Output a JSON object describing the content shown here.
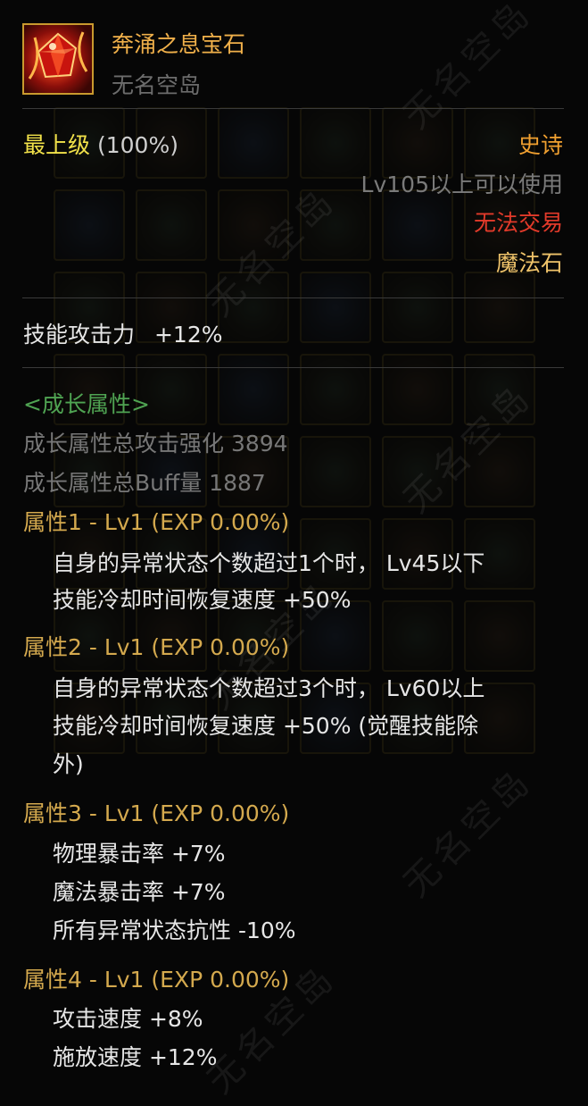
{
  "item": {
    "name": "奔涌之息宝石",
    "source": "无名空岛",
    "grade_name": "最上级",
    "grade_percent": "(100%)",
    "rarity": "史诗",
    "level_requirement": "Lv105以上可以使用",
    "trade_status": "无法交易",
    "category": "魔法石",
    "icon": "red-gem-icon"
  },
  "stats": {
    "skill_attack_label": "技能攻击力",
    "skill_attack_value": "+12%"
  },
  "growth": {
    "header": "<成长属性>",
    "total_attack_label": "成长属性总攻击强化 3894",
    "total_buff_label": "成长属性总Buff量 1887",
    "attributes": [
      {
        "title": "属性1 - Lv1 (EXP 0.00%)",
        "lines": [
          "自身的异常状态个数超过1个时， Lv45以下",
          "技能冷却时间恢复速度 +50%"
        ]
      },
      {
        "title": "属性2 - Lv1 (EXP 0.00%)",
        "lines": [
          "自身的异常状态个数超过3个时， Lv60以上",
          "技能冷却时间恢复速度 +50% (觉醒技能除",
          "外)"
        ]
      },
      {
        "title": "属性3 - Lv1 (EXP 0.00%)",
        "lines": [
          "物理暴击率 +7%",
          "魔法暴击率 +7%",
          "所有异常状态抗性 -10%"
        ]
      },
      {
        "title": "属性4 - Lv1 (EXP 0.00%)",
        "lines": [
          "攻击速度 +8%",
          "施放速度 +12%"
        ]
      }
    ]
  },
  "watermark": "无名空岛",
  "colors": {
    "item_name": "#f0b04a",
    "grade": "#f2e24a",
    "rarity": "#f0a030",
    "trade_locked": "#e23a2a",
    "growth_header": "#4fa352",
    "attribute_title": "#d4a94e"
  }
}
